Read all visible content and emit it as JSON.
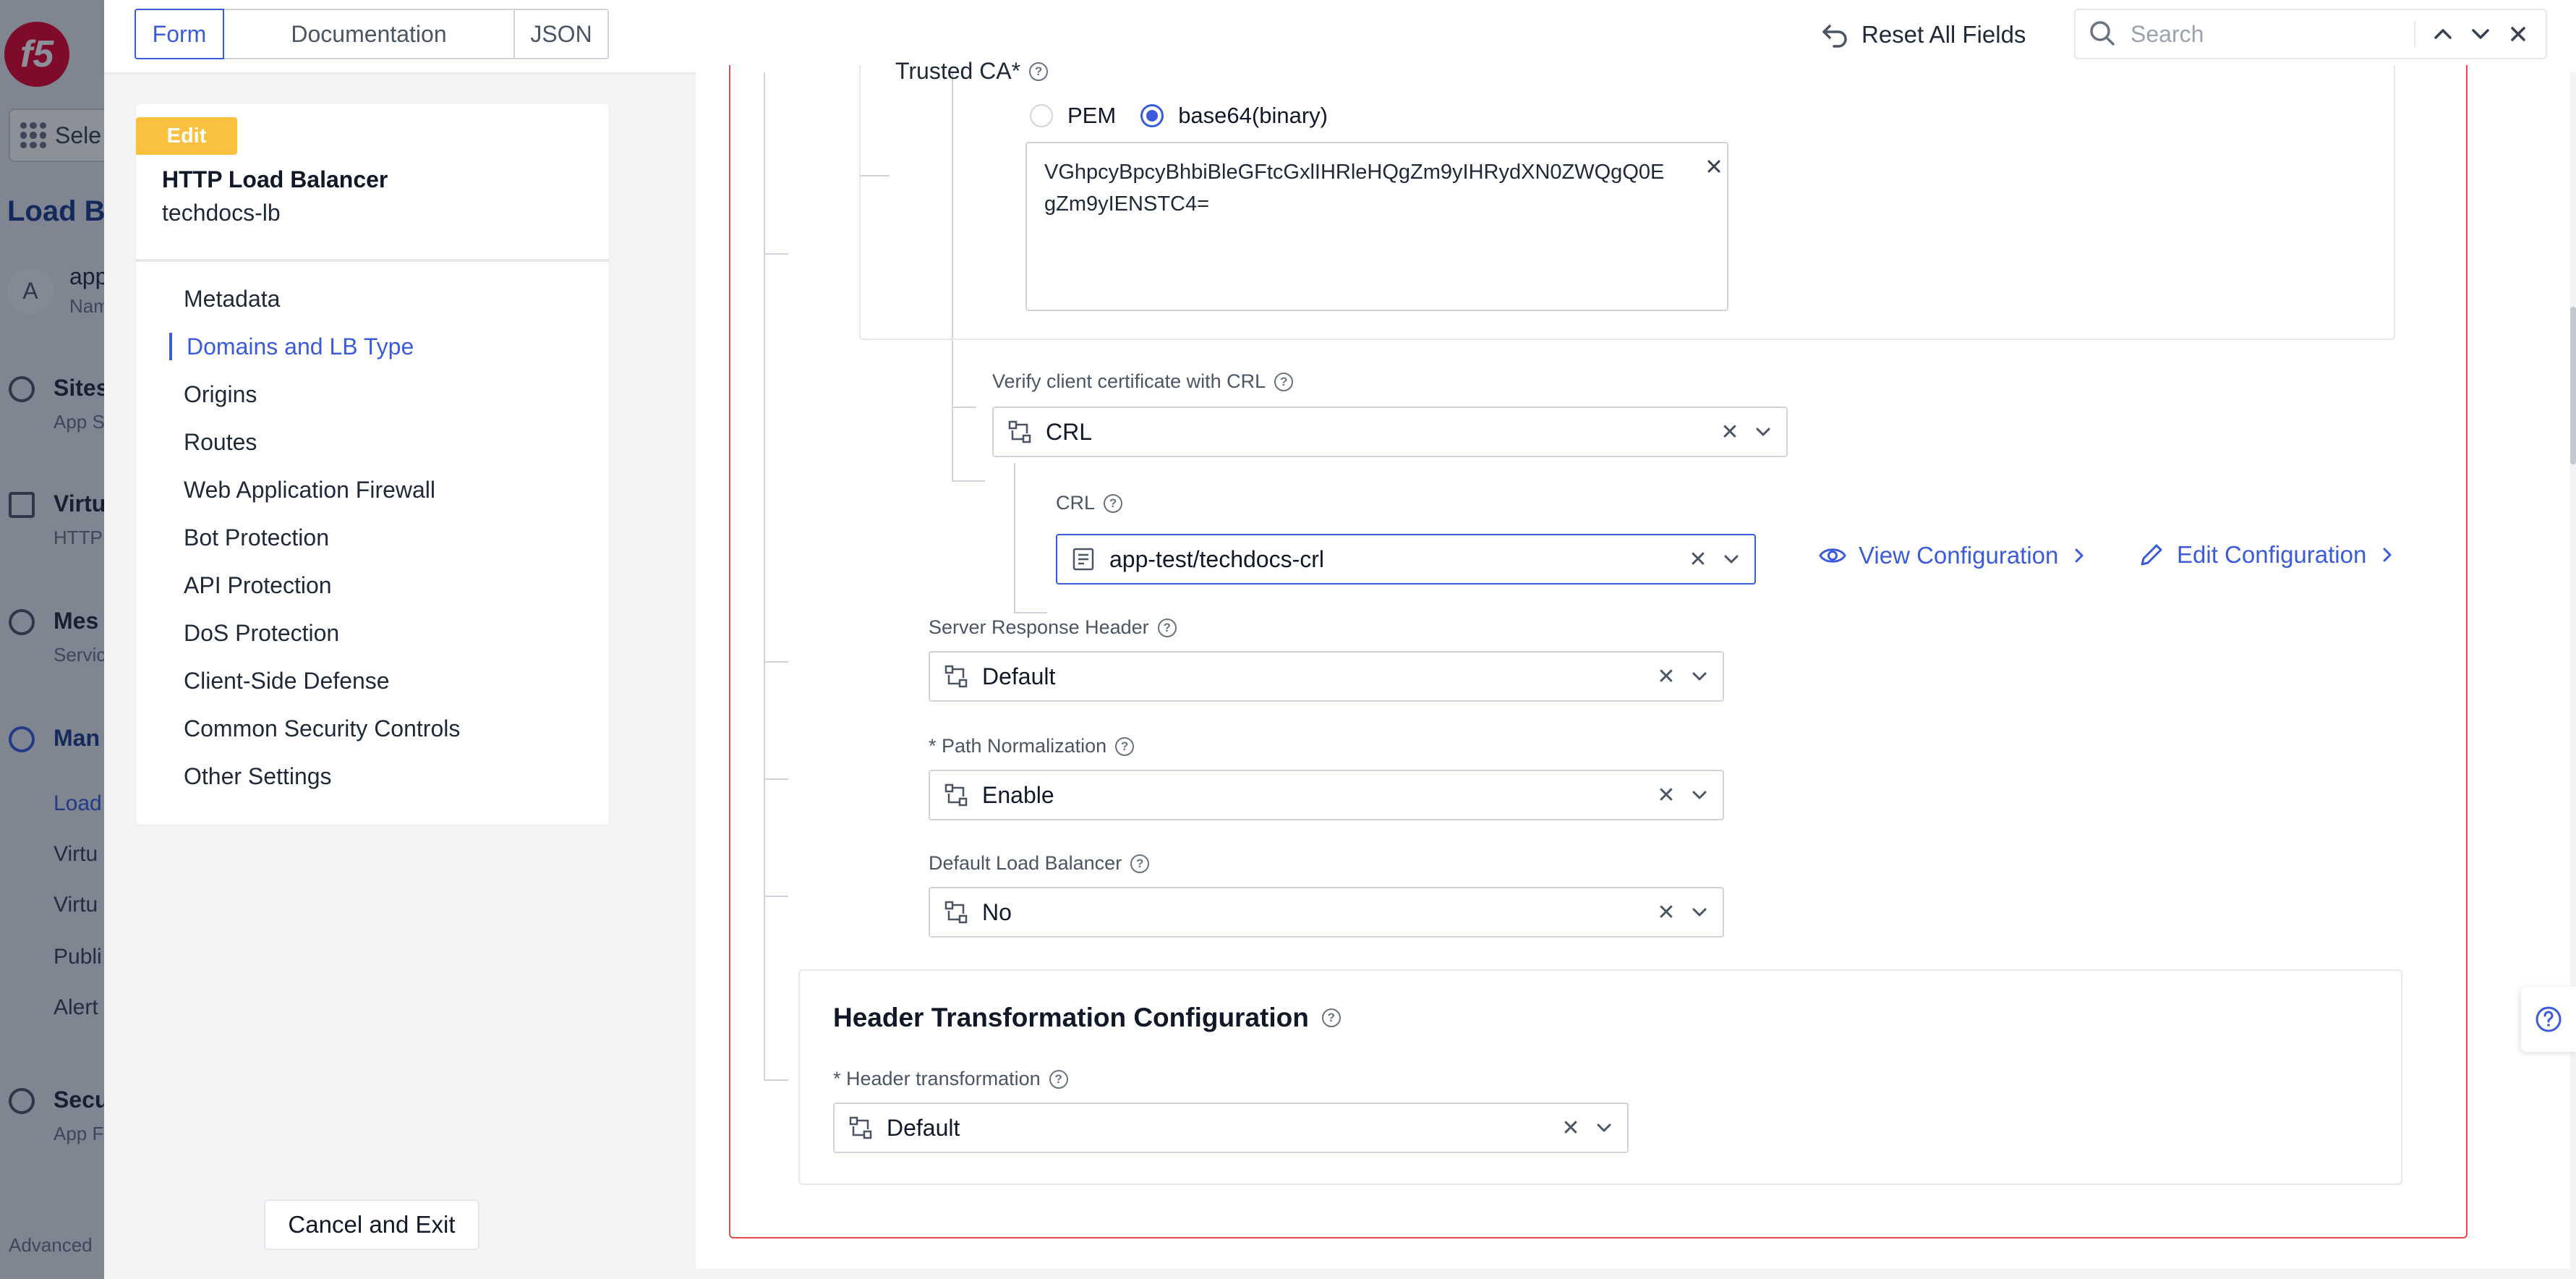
{
  "background_app": {
    "logo": "f5",
    "select_label": "Sele",
    "section_title": "Load Ba",
    "avatar_letter": "A",
    "namespace_name": "app",
    "namespace_sub": "Nam",
    "nav": [
      {
        "title": "Sites",
        "sub": "App S"
      },
      {
        "title": "Virtu",
        "sub": "HTTP"
      },
      {
        "title": "Mes",
        "sub": "Servic"
      },
      {
        "title": "Man",
        "sub": ""
      }
    ],
    "sub_items": [
      "Load",
      "Virtu",
      "Virtu",
      "Publi",
      "Alert"
    ],
    "security": {
      "title": "Secu",
      "sub": "App F"
    },
    "advanced": "Advanced"
  },
  "topbar": {
    "tabs": [
      "Form",
      "Documentation",
      "JSON"
    ],
    "reset_label": "Reset All Fields",
    "search_placeholder": "Search"
  },
  "side_card": {
    "badge": "Edit",
    "object_type": "HTTP Load Balancer",
    "object_name": "techdocs-lb",
    "nav_items": [
      "Metadata",
      "Domains and LB Type",
      "Origins",
      "Routes",
      "Web Application Firewall",
      "Bot Protection",
      "API Protection",
      "DoS Protection",
      "Client-Side Defense",
      "Common Security Controls",
      "Other Settings"
    ],
    "active_index": 1,
    "cancel_label": "Cancel and Exit"
  },
  "form": {
    "trusted_ca": {
      "label": "Trusted CA*",
      "options": [
        "PEM",
        "base64(binary)"
      ],
      "selected": "base64(binary)",
      "value": "VGhpcyBpcyBhbiBleGFtcGxlIHRleHQgZm9yIHRydXN0ZWQgQ0EgZm9yIENSTC4="
    },
    "verify_crl": {
      "label": "Verify client certificate with CRL",
      "value": "CRL"
    },
    "crl": {
      "label": "CRL",
      "value": "app-test/techdocs-crl",
      "view_link": "View Configuration",
      "edit_link": "Edit Configuration"
    },
    "server_response_header": {
      "label": "Server Response Header",
      "value": "Default"
    },
    "path_normalization": {
      "label": "* Path Normalization",
      "value": "Enable"
    },
    "default_lb": {
      "label": "Default Load Balancer",
      "value": "No"
    },
    "header_transformation": {
      "section_title": "Header Transformation Configuration",
      "label": "* Header transformation",
      "value": "Default"
    }
  },
  "colors": {
    "accent": "#3b5bdb",
    "error_border": "#e5484d",
    "edit_badge": "#f9c13d"
  }
}
